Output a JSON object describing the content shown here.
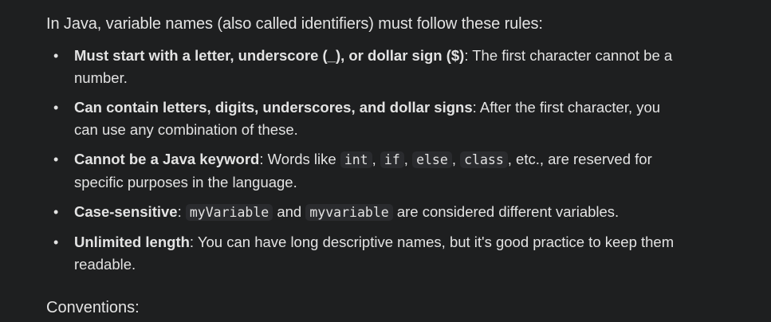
{
  "intro": "In Java, variable names (also called identifiers) must follow these rules:",
  "rules": [
    {
      "term": "Must start with a letter, underscore (_), or dollar sign ($)",
      "text": ": The first character cannot be a number."
    },
    {
      "term": "Can contain letters, digits, underscores, and dollar signs",
      "text": ": After the first character, you can use any combination of these."
    },
    {
      "term": "Cannot be a Java keyword",
      "text_before": ": Words like ",
      "codes": [
        "int",
        "if",
        "else",
        "class"
      ],
      "sep": ", ",
      "text_after": ", etc., are reserved for specific purposes in the language."
    },
    {
      "term": "Case-sensitive",
      "text_before": ": ",
      "code1": "myVariable",
      "text_mid": " and ",
      "code2": "myvariable",
      "text_after": " are considered different variables."
    },
    {
      "term": "Unlimited length",
      "text": ": You can have long descriptive names, but it's good practice to keep them readable."
    }
  ],
  "conventions_heading": "Conventions:",
  "colors": {
    "background": "#1e1f20",
    "text": "#e3e3e3",
    "code_background": "#2a2b2e"
  }
}
